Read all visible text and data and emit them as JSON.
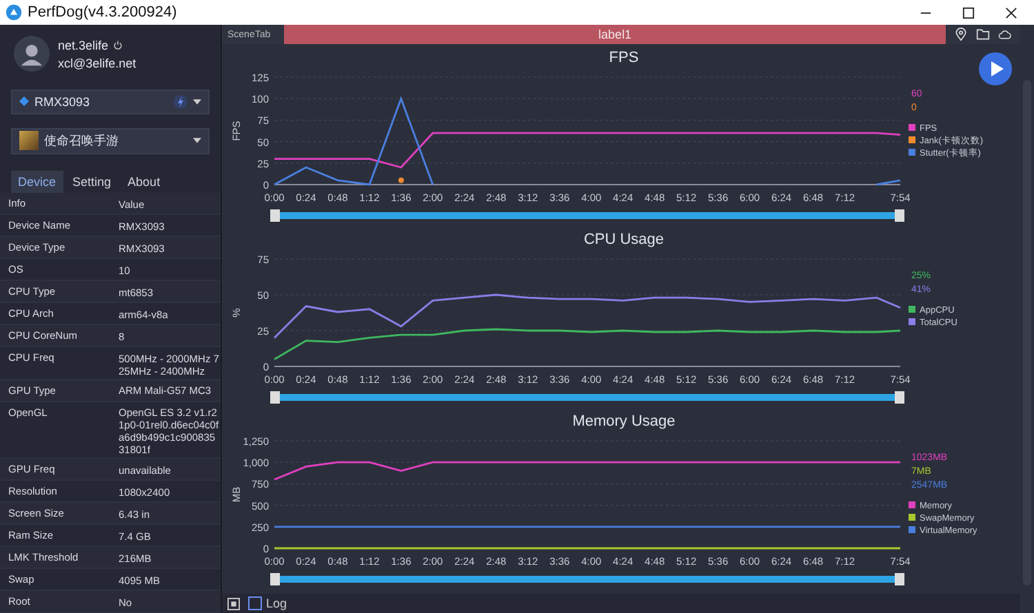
{
  "window": {
    "title": "PerfDog(v4.3.200924)"
  },
  "user": {
    "name": "net.3elife",
    "email": "xcl@3elife.net"
  },
  "device_select": {
    "value": "RMX3093"
  },
  "app_select": {
    "value": "使命召唤手游"
  },
  "tabs": [
    {
      "label": "Device",
      "selected": true
    },
    {
      "label": "Setting",
      "selected": false
    },
    {
      "label": "About",
      "selected": false
    }
  ],
  "info_table": {
    "columns": [
      "Info",
      "Value"
    ],
    "rows": [
      [
        "Device Name",
        "RMX3093"
      ],
      [
        "Device Type",
        "RMX3093"
      ],
      [
        "OS",
        "10"
      ],
      [
        "CPU Type",
        "mt6853"
      ],
      [
        "CPU Arch",
        "arm64-v8a"
      ],
      [
        "CPU CoreNum",
        "8"
      ],
      [
        "CPU Freq",
        "500MHz - 2000MHz 725MHz - 2400MHz"
      ],
      [
        "GPU Type",
        "ARM Mali-G57 MC3"
      ],
      [
        "OpenGL",
        "OpenGL ES 3.2 v1.r21p0-01rel0.d6ec04c0fa6d9b499c1c90083531801f"
      ],
      [
        "GPU Freq",
        "unavailable"
      ],
      [
        "Resolution",
        "1080x2400"
      ],
      [
        "Screen Size",
        "6.43 in"
      ],
      [
        "Ram Size",
        "7.4 GB"
      ],
      [
        "LMK Threshold",
        "216MB"
      ],
      [
        "Swap",
        "4095 MB"
      ],
      [
        "Root",
        "No"
      ]
    ]
  },
  "scene_bar": {
    "tab": "SceneTab",
    "label": "label1"
  },
  "charts": [
    {
      "slider": {
        "level": 1
      },
      "readings": [
        {
          "text": "60",
          "color": "#e040c0"
        },
        {
          "text": "0",
          "color": "#f08a30"
        }
      ],
      "chart_data": {
        "type": "line",
        "title": "FPS",
        "ylabel": "FPS",
        "x": [
          0,
          24,
          48,
          72,
          96,
          120,
          144,
          168,
          192,
          216,
          240,
          264,
          288,
          312,
          336,
          360,
          384,
          408,
          432,
          456,
          474
        ],
        "series": [
          {
            "name": "FPS",
            "color": "#e040c0",
            "values": [
              30,
              30,
              30,
              30,
              20,
              60,
              60,
              60,
              60,
              60,
              60,
              60,
              60,
              60,
              60,
              60,
              60,
              60,
              60,
              60,
              58
            ]
          },
          {
            "name": "Jank(卡顿次数)",
            "color": "#f08a30",
            "marker": true,
            "values": [
              null,
              null,
              null,
              null,
              5,
              null,
              null,
              null,
              null,
              null,
              null,
              null,
              null,
              null,
              null,
              null,
              null,
              null,
              null,
              null,
              null
            ]
          },
          {
            "name": "Stutter(卡顿率)",
            "color": "#4a7fe0",
            "values": [
              0,
              20,
              5,
              0,
              100,
              0,
              null,
              null,
              null,
              null,
              null,
              null,
              null,
              null,
              null,
              null,
              null,
              null,
              null,
              0,
              5
            ]
          }
        ],
        "xlim": [
          0,
          474
        ],
        "grid": true,
        "legend": "right",
        "ylim": [
          0,
          125
        ],
        "yticks": [
          0,
          25,
          50,
          75,
          100,
          125
        ],
        "xticks": [
          {
            "value": 0,
            "label": "0:00"
          },
          {
            "value": 24,
            "label": "0:24"
          },
          {
            "value": 48,
            "label": "0:48"
          },
          {
            "value": 72,
            "label": "1:12"
          },
          {
            "value": 96,
            "label": "1:36"
          },
          {
            "value": 120,
            "label": "2:00"
          },
          {
            "value": 144,
            "label": "2:24"
          },
          {
            "value": 168,
            "label": "2:48"
          },
          {
            "value": 192,
            "label": "3:12"
          },
          {
            "value": 216,
            "label": "3:36"
          },
          {
            "value": 240,
            "label": "4:00"
          },
          {
            "value": 264,
            "label": "4:24"
          },
          {
            "value": 288,
            "label": "4:48"
          },
          {
            "value": 312,
            "label": "5:12"
          },
          {
            "value": 336,
            "label": "5:36"
          },
          {
            "value": 360,
            "label": "6:00"
          },
          {
            "value": 384,
            "label": "6:24"
          },
          {
            "value": 408,
            "label": "6:48"
          },
          {
            "value": 432,
            "label": "7:12"
          },
          {
            "value": 474,
            "label": "7:54"
          }
        ]
      }
    },
    {
      "slider": {
        "level": 1
      },
      "readings": [
        {
          "text": "25%",
          "color": "#3fb860"
        },
        {
          "text": "41%",
          "color": "#8a7ee8"
        }
      ],
      "chart_data": {
        "type": "line",
        "title": "CPU Usage",
        "ylabel": "%",
        "x": [
          0,
          24,
          48,
          72,
          96,
          120,
          144,
          168,
          192,
          216,
          240,
          264,
          288,
          312,
          336,
          360,
          384,
          408,
          432,
          456,
          474
        ],
        "series": [
          {
            "name": "AppCPU",
            "color": "#3fb860",
            "values": [
              5,
              18,
              17,
              20,
              22,
              22,
              25,
              26,
              25,
              25,
              24,
              25,
              24,
              24,
              25,
              24,
              24,
              25,
              24,
              24,
              25
            ]
          },
          {
            "name": "TotalCPU",
            "color": "#8a7ee8",
            "values": [
              20,
              42,
              38,
              40,
              28,
              46,
              48,
              50,
              48,
              47,
              47,
              46,
              48,
              48,
              47,
              45,
              46,
              47,
              46,
              48,
              41
            ]
          }
        ],
        "xlim": [
          0,
          474
        ],
        "grid": true,
        "legend": "right",
        "ylim": [
          0,
          75
        ],
        "yticks": [
          0,
          25,
          50,
          75
        ],
        "xticks": [
          {
            "value": 0,
            "label": "0:00"
          },
          {
            "value": 24,
            "label": "0:24"
          },
          {
            "value": 48,
            "label": "0:48"
          },
          {
            "value": 72,
            "label": "1:12"
          },
          {
            "value": 96,
            "label": "1:36"
          },
          {
            "value": 120,
            "label": "2:00"
          },
          {
            "value": 144,
            "label": "2:24"
          },
          {
            "value": 168,
            "label": "2:48"
          },
          {
            "value": 192,
            "label": "3:12"
          },
          {
            "value": 216,
            "label": "3:36"
          },
          {
            "value": 240,
            "label": "4:00"
          },
          {
            "value": 264,
            "label": "4:24"
          },
          {
            "value": 288,
            "label": "4:48"
          },
          {
            "value": 312,
            "label": "5:12"
          },
          {
            "value": 336,
            "label": "5:36"
          },
          {
            "value": 360,
            "label": "6:00"
          },
          {
            "value": 384,
            "label": "6:24"
          },
          {
            "value": 408,
            "label": "6:48"
          },
          {
            "value": 432,
            "label": "7:12"
          },
          {
            "value": 474,
            "label": "7:54"
          }
        ]
      }
    },
    {
      "slider": {
        "level": 1
      },
      "readings": [
        {
          "text": "1023MB",
          "color": "#e040c0"
        },
        {
          "text": "7MB",
          "color": "#a8c830"
        },
        {
          "text": "2547MB",
          "color": "#4a7fe0"
        }
      ],
      "chart_data": {
        "type": "line",
        "title": "Memory Usage",
        "ylabel": "MB",
        "x": [
          0,
          24,
          48,
          72,
          96,
          120,
          144,
          168,
          192,
          216,
          240,
          264,
          288,
          312,
          336,
          360,
          384,
          408,
          432,
          456,
          474
        ],
        "series": [
          {
            "name": "Memory",
            "color": "#e040c0",
            "values": [
              800,
              950,
              1000,
              1000,
              900,
              1000,
              1000,
              1000,
              1000,
              1000,
              1000,
              1000,
              1000,
              1000,
              1000,
              1000,
              1000,
              1000,
              1000,
              1000,
              1000
            ]
          },
          {
            "name": "SwapMemory",
            "color": "#a8c830",
            "values": [
              0,
              0,
              0,
              0,
              0,
              0,
              0,
              0,
              0,
              0,
              0,
              0,
              0,
              0,
              0,
              0,
              0,
              0,
              0,
              0,
              0
            ]
          },
          {
            "name": "VirtualMemory",
            "color": "#4a7fe0",
            "values": [
              250,
              250,
              250,
              250,
              250,
              250,
              250,
              250,
              250,
              250,
              250,
              250,
              250,
              250,
              250,
              250,
              250,
              250,
              250,
              250,
              250
            ]
          }
        ],
        "xlim": [
          0,
          474
        ],
        "grid": true,
        "legend": "right",
        "ylim": [
          0,
          1250
        ],
        "yticks": [
          {
            "value": 0,
            "label": "0"
          },
          {
            "value": 250,
            "label": "250"
          },
          {
            "value": 500,
            "label": "500"
          },
          {
            "value": 750,
            "label": "750"
          },
          {
            "value": 1000,
            "label": "1,000"
          },
          {
            "value": 1250,
            "label": "1,250"
          }
        ],
        "xticks": [
          {
            "value": 0,
            "label": "0:00"
          },
          {
            "value": 24,
            "label": "0:24"
          },
          {
            "value": 48,
            "label": "0:48"
          },
          {
            "value": 72,
            "label": "1:12"
          },
          {
            "value": 96,
            "label": "1:36"
          },
          {
            "value": 120,
            "label": "2:00"
          },
          {
            "value": 144,
            "label": "2:24"
          },
          {
            "value": 168,
            "label": "2:48"
          },
          {
            "value": 192,
            "label": "3:12"
          },
          {
            "value": 216,
            "label": "3:36"
          },
          {
            "value": 240,
            "label": "4:00"
          },
          {
            "value": 264,
            "label": "4:24"
          },
          {
            "value": 288,
            "label": "4:48"
          },
          {
            "value": 312,
            "label": "5:12"
          },
          {
            "value": 336,
            "label": "5:36"
          },
          {
            "value": 360,
            "label": "6:00"
          },
          {
            "value": 384,
            "label": "6:24"
          },
          {
            "value": 408,
            "label": "6:48"
          },
          {
            "value": 432,
            "label": "7:12"
          },
          {
            "value": 474,
            "label": "7:54"
          }
        ]
      }
    }
  ],
  "log": {
    "label": "Log",
    "checked": false
  }
}
